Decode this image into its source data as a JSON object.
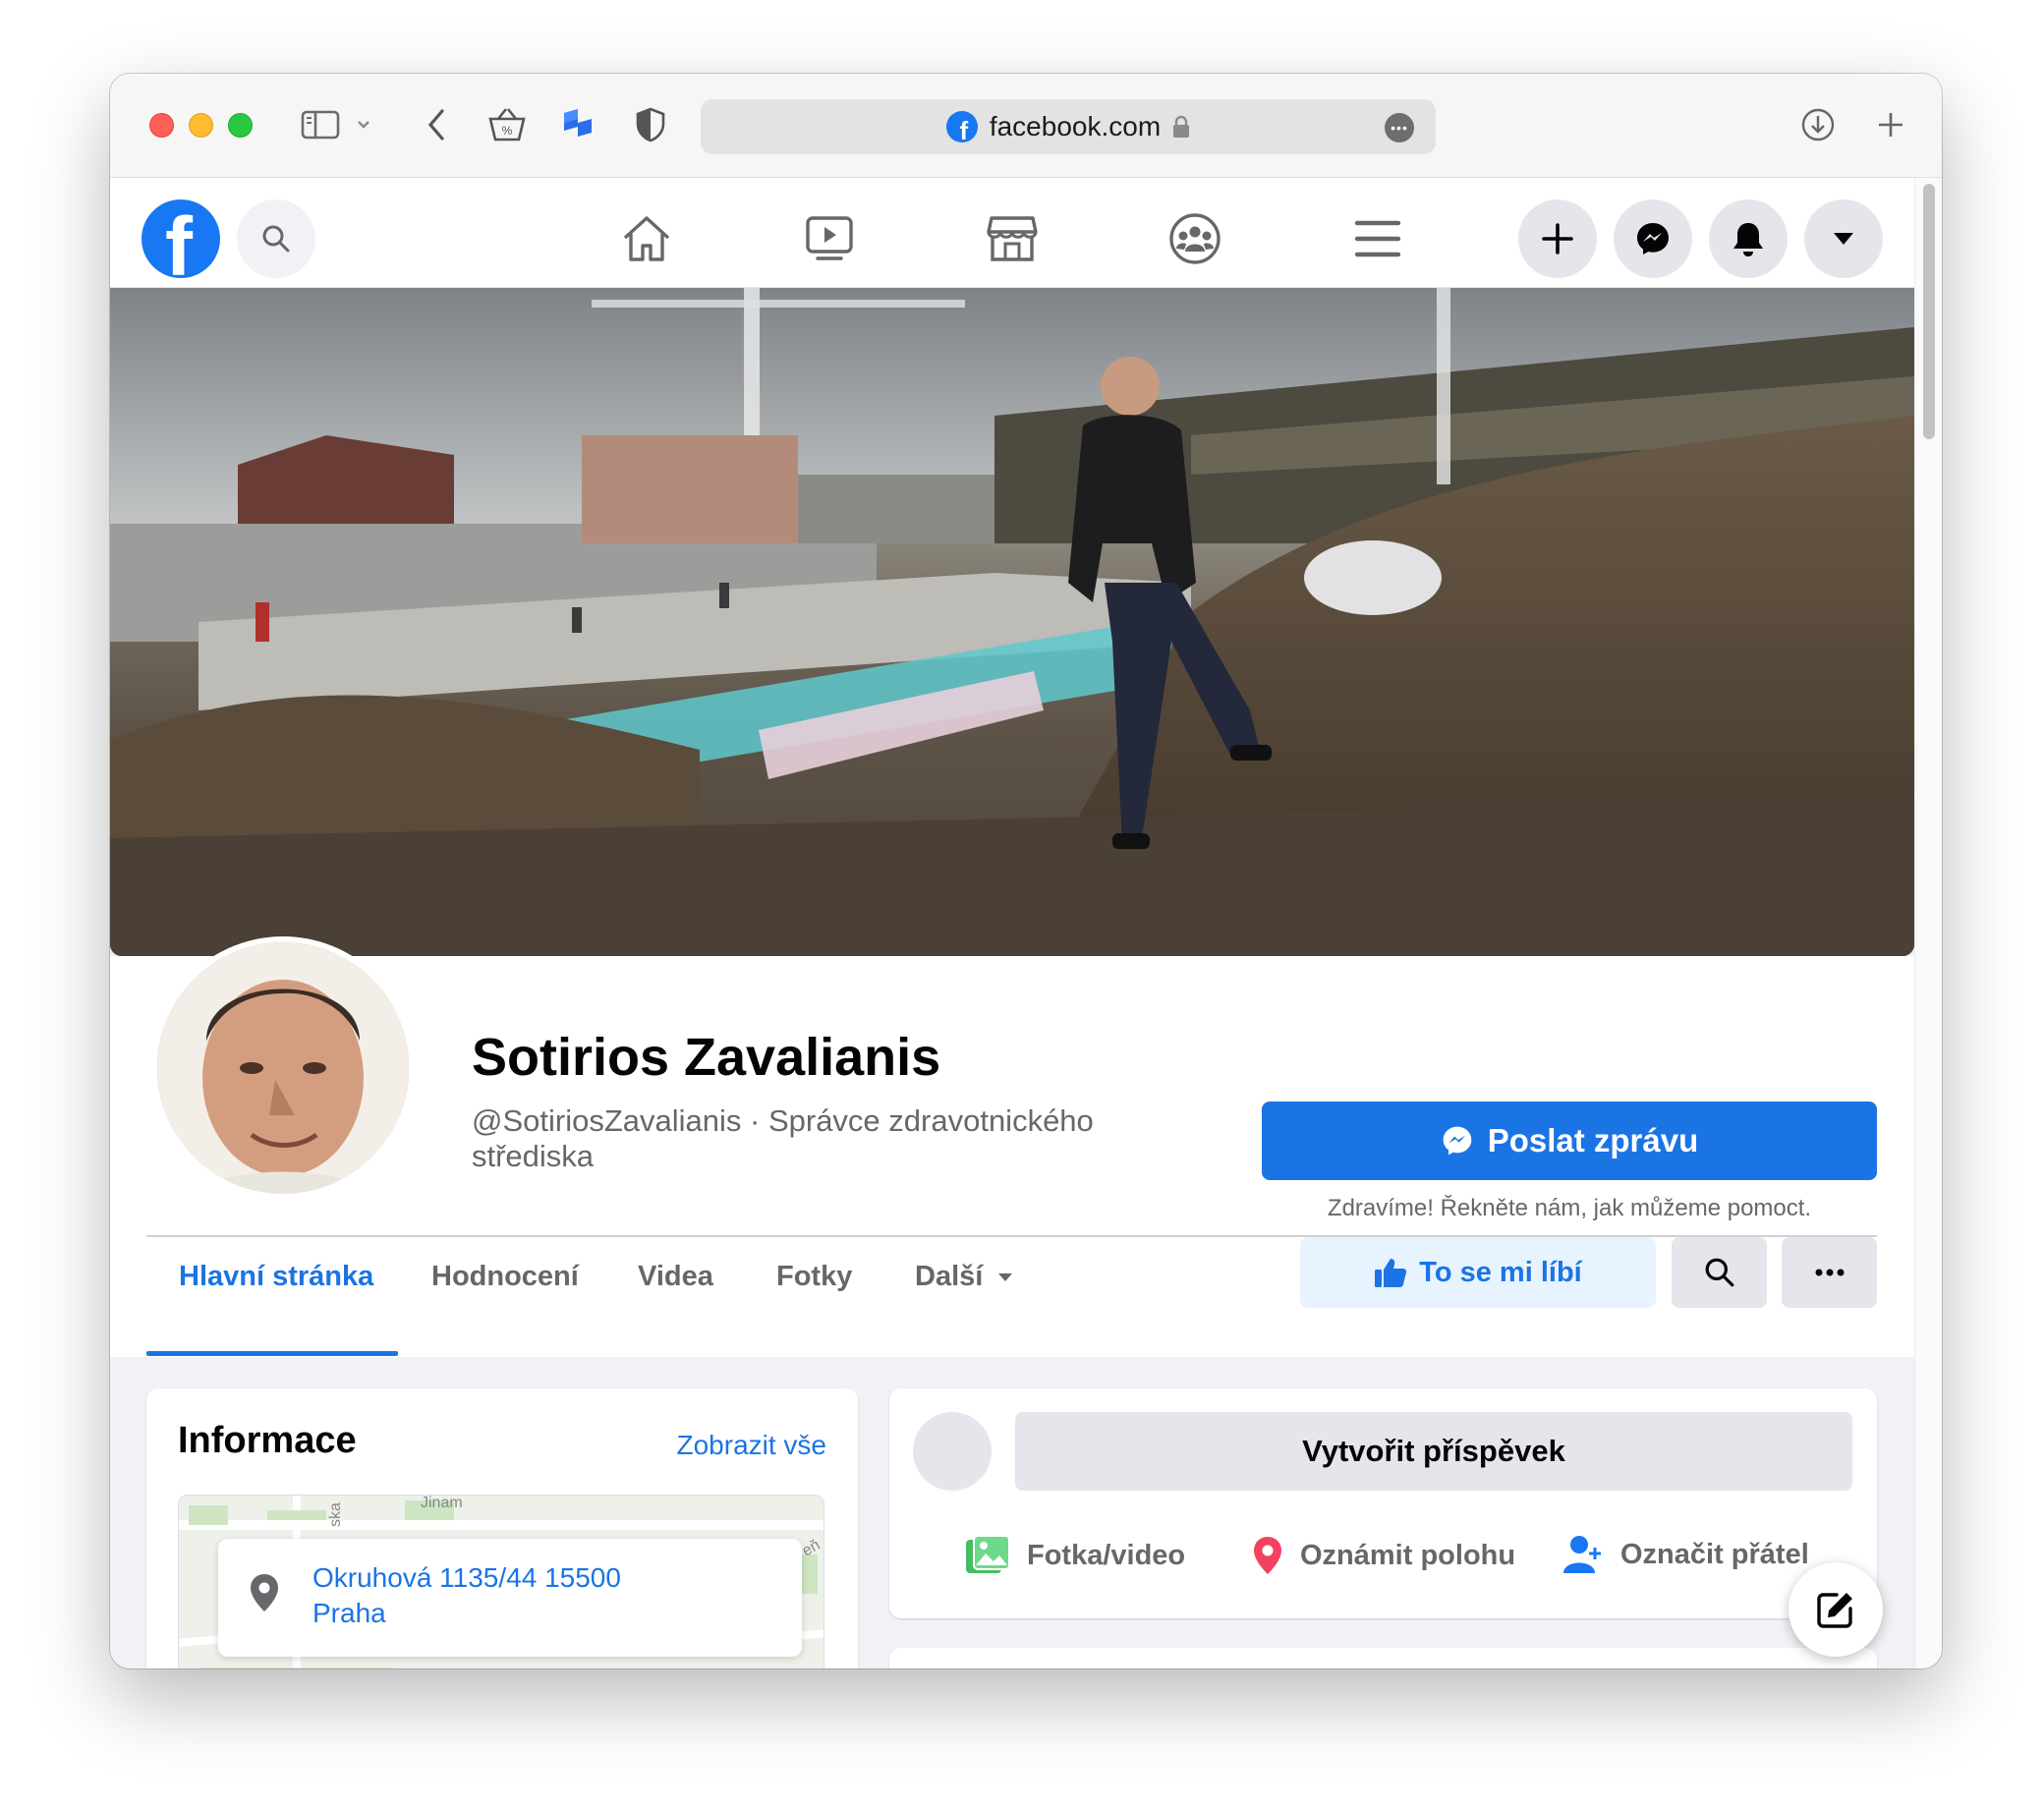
{
  "browser": {
    "url": "facebook.com",
    "icons": [
      "sidebar-icon",
      "chevron-down-icon",
      "back-icon",
      "basket-icon",
      "extension-icon",
      "shield-icon",
      "lock-icon",
      "more-icon",
      "download-icon",
      "new-tab-icon"
    ]
  },
  "fb_nav": {
    "logo_letter": "f",
    "icons": [
      "search-icon",
      "home-icon",
      "watch-icon",
      "marketplace-icon",
      "groups-icon",
      "menu-icon",
      "create-icon",
      "messenger-icon",
      "notifications-icon",
      "account-menu-icon"
    ]
  },
  "profile": {
    "name": "Sotirios Zavalianis",
    "handle_line1": "@SotiriosZavalianis · Správce zdravotnického",
    "handle_line2": "střediska",
    "send_message": "Poslat zprávu",
    "send_message_sub": "Zdravíme! Řekněte nám, jak můžeme pomoct.",
    "like": "To se mi líbí"
  },
  "tabs": [
    {
      "label": "Hlavní stránka",
      "active": true
    },
    {
      "label": "Hodnocení",
      "active": false
    },
    {
      "label": "Videa",
      "active": false
    },
    {
      "label": "Fotky",
      "active": false
    },
    {
      "label": "Další",
      "active": false
    }
  ],
  "info": {
    "title": "Informace",
    "show_all": "Zobrazit vše",
    "address_line1": "Okruhová 1135/44 15500",
    "address_line2": "Praha",
    "map_label_1": "Jinam",
    "map_label_2": "ska",
    "map_label_3": "eň"
  },
  "composer": {
    "create_post": "Vytvořit příspěvek",
    "photo_video": "Fotka/video",
    "check_in": "Oznámit polohu",
    "tag_friends": "Označit přátel"
  },
  "colors": {
    "facebook_blue": "#1877f2",
    "link_blue": "#1b74e4",
    "background": "#f0f2f5"
  }
}
